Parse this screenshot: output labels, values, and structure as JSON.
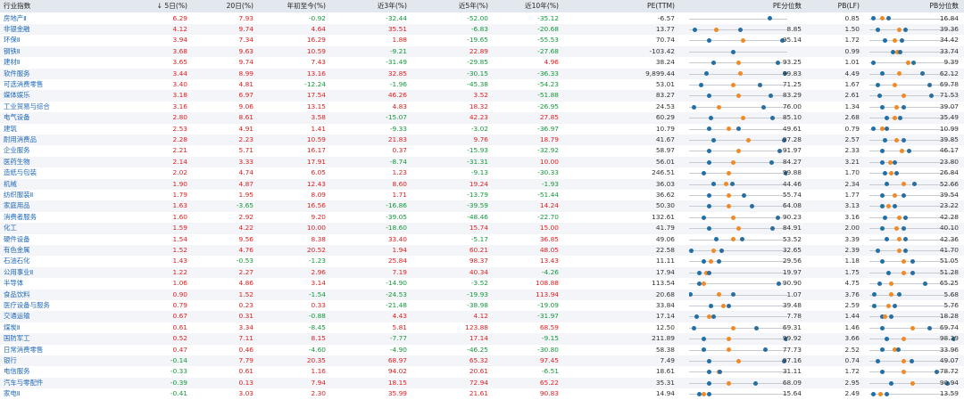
{
  "header": {
    "name": "行业指数",
    "ret5d": "↓ 5日(%)",
    "ret20d": "20日(%)",
    "ytd": "年初至今(%)",
    "ret3y": "近3年(%)",
    "ret5y": "近5年(%)",
    "ret10y": "近10年(%)",
    "pe": "PE(TTM)",
    "pe_pct": "PE分位数",
    "pb": "PB(LF)",
    "pb_pct": "PB分位数"
  },
  "colors": {
    "positive": "#e02020",
    "negative": "#12993a",
    "link": "#1e67b8",
    "marker_current": "#1f6fa8",
    "marker_median": "#f08a24"
  },
  "rows": [
    {
      "name": "房地产Ⅱ",
      "r5": "6.29",
      "r20": "7.93",
      "ytd": "-0.92",
      "r3": "-32.44",
      "y5": "-52.00",
      "y10": "-35.12",
      "pe": "-6.57",
      "pe_pct": "",
      "pb": "0.85",
      "pb_pct": "16.84",
      "pe_m": [
        0.0,
        0.82,
        0.82
      ],
      "pb_m": [
        0.05,
        0.15,
        0.22
      ]
    },
    {
      "name": "非银金融",
      "r5": "4.12",
      "r20": "9.74",
      "ytd": "4.64",
      "r3": "35.51",
      "y5": "-6.83",
      "y10": "-20.68",
      "pe": "13.77",
      "pe_pct": "8.85",
      "pb": "1.50",
      "pb_pct": "39.36",
      "pe_m": [
        0.06,
        0.28,
        0.52
      ],
      "pb_m": [
        0.1,
        0.35,
        0.42
      ]
    },
    {
      "name": "环保Ⅱ",
      "r5": "3.94",
      "r20": "7.34",
      "ytd": "16.29",
      "r3": "1.88",
      "y5": "-19.65",
      "y10": "-55.53",
      "pe": "70.74",
      "pe_pct": "95.14",
      "pb": "1.72",
      "pb_pct": "34.42",
      "pe_m": [
        0.2,
        0.55,
        0.95
      ],
      "pb_m": [
        0.18,
        0.3,
        0.38
      ]
    },
    {
      "name": "钢铁Ⅱ",
      "r5": "3.68",
      "r20": "9.63",
      "ytd": "10.59",
      "r3": "-9.21",
      "y5": "22.89",
      "y10": "-27.68",
      "pe": "-103.42",
      "pe_pct": "",
      "pb": "0.99",
      "pb_pct": "33.74",
      "pe_m": [
        0.0,
        0.45,
        0.45
      ],
      "pb_m": [
        0.28,
        0.33,
        0.36
      ]
    },
    {
      "name": "建材Ⅱ",
      "r5": "3.65",
      "r20": "9.74",
      "ytd": "7.43",
      "r3": "-31.49",
      "y5": "-29.85",
      "y10": "4.96",
      "pe": "38.24",
      "pe_pct": "93.25",
      "pb": "1.01",
      "pb_pct": "9.39",
      "pe_m": [
        0.25,
        0.5,
        0.9
      ],
      "pb_m": [
        0.05,
        0.45,
        0.52
      ]
    },
    {
      "name": "软件服务",
      "r5": "3.44",
      "r20": "8.99",
      "ytd": "13.16",
      "r3": "32.85",
      "y5": "-30.15",
      "y10": "-36.33",
      "pe": "9,899.44",
      "pe_pct": "99.83",
      "pb": "4.49",
      "pb_pct": "62.12",
      "pe_m": [
        0.18,
        0.52,
        0.98
      ],
      "pb_m": [
        0.15,
        0.35,
        0.62
      ]
    },
    {
      "name": "可选消费零售",
      "r5": "3.40",
      "r20": "4.81",
      "ytd": "-12.24",
      "r3": "-1.96",
      "y5": "-45.38",
      "y10": "-54.23",
      "pe": "53.01",
      "pe_pct": "71.25",
      "pb": "1.67",
      "pb_pct": "69.78",
      "pe_m": [
        0.12,
        0.45,
        0.72
      ],
      "pb_m": [
        0.1,
        0.3,
        0.7
      ]
    },
    {
      "name": "媒体娱乐",
      "r5": "3.18",
      "r20": "6.97",
      "ytd": "17.54",
      "r3": "46.26",
      "y5": "3.52",
      "y10": "-51.88",
      "pe": "83.27",
      "pe_pct": "83.29",
      "pb": "2.61",
      "pb_pct": "71.53",
      "pe_m": [
        0.2,
        0.5,
        0.83
      ],
      "pb_m": [
        0.12,
        0.4,
        0.72
      ]
    },
    {
      "name": "工业贸易与综合",
      "r5": "3.16",
      "r20": "9.06",
      "ytd": "13.15",
      "r3": "4.83",
      "y5": "18.32",
      "y10": "-26.95",
      "pe": "24.53",
      "pe_pct": "76.00",
      "pb": "1.34",
      "pb_pct": "39.07",
      "pe_m": [
        0.05,
        0.3,
        0.76
      ],
      "pb_m": [
        0.15,
        0.32,
        0.4
      ]
    },
    {
      "name": "电气设备",
      "r5": "2.80",
      "r20": "8.61",
      "ytd": "3.58",
      "r3": "-15.07",
      "y5": "42.23",
      "y10": "27.85",
      "pe": "60.29",
      "pe_pct": "85.10",
      "pb": "2.68",
      "pb_pct": "35.49",
      "pe_m": [
        0.22,
        0.55,
        0.85
      ],
      "pb_m": [
        0.2,
        0.3,
        0.36
      ]
    },
    {
      "name": "建筑",
      "r5": "2.53",
      "r20": "4.91",
      "ytd": "1.41",
      "r3": "-9.33",
      "y5": "-3.02",
      "y10": "-36.97",
      "pe": "10.79",
      "pe_pct": "49.61",
      "pb": "0.79",
      "pb_pct": "10.99",
      "pe_m": [
        0.2,
        0.4,
        0.5
      ],
      "pb_m": [
        0.05,
        0.15,
        0.2
      ]
    },
    {
      "name": "耐用消费品",
      "r5": "2.28",
      "r20": "2.23",
      "ytd": "10.59",
      "r3": "21.83",
      "y5": "9.76",
      "y10": "18.79",
      "pe": "41.67",
      "pe_pct": "97.28",
      "pb": "2.57",
      "pb_pct": "39.85",
      "pe_m": [
        0.25,
        0.6,
        0.97
      ],
      "pb_m": [
        0.18,
        0.32,
        0.4
      ]
    },
    {
      "name": "企业服务",
      "r5": "2.21",
      "r20": "5.71",
      "ytd": "16.17",
      "r3": "0.37",
      "y5": "-15.93",
      "y10": "-32.92",
      "pe": "58.97",
      "pe_pct": "91.97",
      "pb": "2.33",
      "pb_pct": "46.17",
      "pe_m": [
        0.2,
        0.5,
        0.92
      ],
      "pb_m": [
        0.15,
        0.38,
        0.46
      ]
    },
    {
      "name": "医药生物",
      "r5": "2.14",
      "r20": "3.33",
      "ytd": "17.91",
      "r3": "-8.74",
      "y5": "-31.31",
      "y10": "10.00",
      "pe": "56.01",
      "pe_pct": "84.27",
      "pb": "3.21",
      "pb_pct": "23.80",
      "pe_m": [
        0.2,
        0.45,
        0.84
      ],
      "pb_m": [
        0.15,
        0.24,
        0.3
      ]
    },
    {
      "name": "造纸与包装",
      "r5": "2.02",
      "r20": "4.74",
      "ytd": "6.05",
      "r3": "1.23",
      "y5": "-9.13",
      "y10": "-30.33",
      "pe": "246.51",
      "pe_pct": "99.88",
      "pb": "1.70",
      "pb_pct": "26.84",
      "pe_m": [
        0.15,
        0.4,
        0.99
      ],
      "pb_m": [
        0.18,
        0.26,
        0.32
      ]
    },
    {
      "name": "机械",
      "r5": "1.90",
      "r20": "4.87",
      "ytd": "12.43",
      "r3": "8.60",
      "y5": "19.24",
      "y10": "-1.93",
      "pe": "36.03",
      "pe_pct": "44.46",
      "pb": "2.34",
      "pb_pct": "52.66",
      "pe_m": [
        0.25,
        0.38,
        0.44
      ],
      "pb_m": [
        0.2,
        0.4,
        0.53
      ]
    },
    {
      "name": "纺织服装Ⅱ",
      "r5": "1.79",
      "r20": "1.95",
      "ytd": "8.09",
      "r3": "1.71",
      "y5": "-13.79",
      "y10": "-51.44",
      "pe": "36.62",
      "pe_pct": "55.74",
      "pb": "1.77",
      "pb_pct": "39.54",
      "pe_m": [
        0.2,
        0.4,
        0.56
      ],
      "pb_m": [
        0.15,
        0.3,
        0.4
      ]
    },
    {
      "name": "家庭用品",
      "r5": "1.63",
      "r20": "-3.65",
      "ytd": "16.56",
      "r3": "-16.86",
      "y5": "-39.59",
      "y10": "14.24",
      "pe": "50.30",
      "pe_pct": "64.08",
      "pb": "3.13",
      "pb_pct": "23.22",
      "pe_m": [
        0.2,
        0.4,
        0.64
      ],
      "pb_m": [
        0.15,
        0.22,
        0.3
      ]
    },
    {
      "name": "消费者服务",
      "r5": "1.60",
      "r20": "2.92",
      "ytd": "9.20",
      "r3": "-39.05",
      "y5": "-48.46",
      "y10": "-22.70",
      "pe": "132.61",
      "pe_pct": "90.23",
      "pb": "3.16",
      "pb_pct": "42.28",
      "pe_m": [
        0.15,
        0.45,
        0.9
      ],
      "pb_m": [
        0.18,
        0.35,
        0.42
      ]
    },
    {
      "name": "化工",
      "r5": "1.59",
      "r20": "4.22",
      "ytd": "10.00",
      "r3": "-18.60",
      "y5": "15.74",
      "y10": "15.00",
      "pe": "41.79",
      "pe_pct": "84.91",
      "pb": "2.00",
      "pb_pct": "40.10",
      "pe_m": [
        0.2,
        0.5,
        0.85
      ],
      "pb_m": [
        0.15,
        0.32,
        0.4
      ]
    },
    {
      "name": "硬件设备",
      "r5": "1.54",
      "r20": "9.56",
      "ytd": "8.38",
      "r3": "33.40",
      "y5": "-5.17",
      "y10": "36.85",
      "pe": "49.06",
      "pe_pct": "53.52",
      "pb": "3.39",
      "pb_pct": "42.36",
      "pe_m": [
        0.28,
        0.45,
        0.54
      ],
      "pb_m": [
        0.2,
        0.35,
        0.42
      ]
    },
    {
      "name": "有色金属",
      "r5": "1.52",
      "r20": "4.76",
      "ytd": "20.52",
      "r3": "1.94",
      "y5": "60.21",
      "y10": "48.05",
      "pe": "22.58",
      "pe_pct": "32.65",
      "pb": "2.39",
      "pb_pct": "41.70",
      "pe_m": [
        0.02,
        0.25,
        0.33
      ],
      "pb_m": [
        0.1,
        0.35,
        0.42
      ]
    },
    {
      "name": "石油石化",
      "r5": "1.43",
      "r20": "-0.53",
      "ytd": "-1.23",
      "r3": "25.84",
      "y5": "98.37",
      "y10": "13.43",
      "pe": "11.11",
      "pe_pct": "29.56",
      "pb": "1.18",
      "pb_pct": "51.05",
      "pe_m": [
        0.15,
        0.22,
        0.3
      ],
      "pb_m": [
        0.15,
        0.4,
        0.51
      ]
    },
    {
      "name": "公用事业Ⅱ",
      "r5": "1.22",
      "r20": "2.27",
      "ytd": "2.96",
      "r3": "7.19",
      "y5": "40.34",
      "y10": "-4.26",
      "pe": "17.94",
      "pe_pct": "19.97",
      "pb": "1.75",
      "pb_pct": "51.28",
      "pe_m": [
        0.1,
        0.18,
        0.2
      ],
      "pb_m": [
        0.22,
        0.4,
        0.51
      ]
    },
    {
      "name": "半导体",
      "r5": "1.06",
      "r20": "4.86",
      "ytd": "3.14",
      "r3": "-14.90",
      "y5": "-3.52",
      "y10": "108.88",
      "pe": "113.54",
      "pe_pct": "90.90",
      "pb": "4.75",
      "pb_pct": "65.25",
      "pe_m": [
        0.1,
        0.15,
        0.91
      ],
      "pb_m": [
        0.12,
        0.25,
        0.65
      ]
    },
    {
      "name": "食品饮料",
      "r5": "0.90",
      "r20": "1.52",
      "ytd": "-1.54",
      "r3": "-24.53",
      "y5": "-19.93",
      "y10": "113.94",
      "pe": "20.68",
      "pe_pct": "1.07",
      "pb": "3.76",
      "pb_pct": "5.68",
      "pe_m": [
        0.01,
        0.3,
        0.45
      ],
      "pb_m": [
        0.06,
        0.25,
        0.35
      ]
    },
    {
      "name": "医疗设备与服务",
      "r5": "0.79",
      "r20": "0.23",
      "ytd": "0.33",
      "r3": "-21.48",
      "y5": "-38.98",
      "y10": "-19.09",
      "pe": "33.84",
      "pe_pct": "39.48",
      "pb": "2.59",
      "pb_pct": "5.76",
      "pe_m": [
        0.22,
        0.35,
        0.4
      ],
      "pb_m": [
        0.06,
        0.22,
        0.3
      ]
    },
    {
      "name": "交通运输",
      "r5": "0.67",
      "r20": "0.31",
      "ytd": "-0.88",
      "r3": "4.43",
      "y5": "4.12",
      "y10": "-31.97",
      "pe": "17.14",
      "pe_pct": "7.78",
      "pb": "1.44",
      "pb_pct": "18.28",
      "pe_m": [
        0.08,
        0.2,
        0.25
      ],
      "pb_m": [
        0.15,
        0.18,
        0.25
      ]
    },
    {
      "name": "煤炭Ⅱ",
      "r5": "0.61",
      "r20": "3.34",
      "ytd": "-8.45",
      "r3": "5.81",
      "y5": "123.88",
      "y10": "68.59",
      "pe": "12.50",
      "pe_pct": "69.31",
      "pb": "1.46",
      "pb_pct": "69.74",
      "pe_m": [
        0.05,
        0.45,
        0.69
      ],
      "pb_m": [
        0.15,
        0.5,
        0.7
      ]
    },
    {
      "name": "国防军工",
      "r5": "0.52",
      "r20": "7.11",
      "ytd": "8.15",
      "r3": "-7.77",
      "y5": "17.14",
      "y10": "-9.15",
      "pe": "211.89",
      "pe_pct": "99.92",
      "pb": "3.66",
      "pb_pct": "98.39",
      "pe_m": [
        0.15,
        0.4,
        0.99
      ],
      "pb_m": [
        0.2,
        0.4,
        0.98
      ]
    },
    {
      "name": "日常消费零售",
      "r5": "0.47",
      "r20": "0.46",
      "ytd": "-4.60",
      "r3": "-4.90",
      "y5": "-46.25",
      "y10": "-30.80",
      "pe": "58.38",
      "pe_pct": "77.73",
      "pb": "2.52",
      "pb_pct": "33.96",
      "pe_m": [
        0.15,
        0.4,
        0.78
      ],
      "pb_m": [
        0.15,
        0.3,
        0.34
      ]
    },
    {
      "name": "银行",
      "r5": "-0.14",
      "r20": "7.79",
      "ytd": "20.35",
      "r3": "68.97",
      "y5": "65.32",
      "y10": "97.45",
      "pe": "7.49",
      "pe_pct": "97.16",
      "pb": "0.74",
      "pb_pct": "49.07",
      "pe_m": [
        0.2,
        0.5,
        0.97
      ],
      "pb_m": [
        0.1,
        0.4,
        0.49
      ]
    },
    {
      "name": "电信服务",
      "r5": "-0.33",
      "r20": "0.61",
      "ytd": "1.16",
      "r3": "94.02",
      "y5": "20.61",
      "y10": "-6.51",
      "pe": "18.61",
      "pe_pct": "31.11",
      "pb": "1.72",
      "pb_pct": "78.72",
      "pe_m": [
        0.2,
        0.3,
        0.31
      ],
      "pb_m": [
        0.15,
        0.4,
        0.79
      ]
    },
    {
      "name": "汽车与零配件",
      "r5": "-0.39",
      "r20": "0.13",
      "ytd": "7.94",
      "r3": "18.15",
      "y5": "72.94",
      "y10": "65.22",
      "pe": "35.31",
      "pe_pct": "68.09",
      "pb": "2.95",
      "pb_pct": "90.94",
      "pe_m": [
        0.2,
        0.4,
        0.68
      ],
      "pb_m": [
        0.25,
        0.5,
        0.91
      ]
    },
    {
      "name": "家电Ⅱ",
      "r5": "-0.41",
      "r20": "3.03",
      "ytd": "2.30",
      "r3": "35.99",
      "y5": "21.61",
      "y10": "90.83",
      "pe": "14.94",
      "pe_pct": "15.64",
      "pb": "2.49",
      "pb_pct": "13.59",
      "pe_m": [
        0.1,
        0.15,
        0.2
      ],
      "pb_m": [
        0.05,
        0.13,
        0.2
      ]
    }
  ]
}
